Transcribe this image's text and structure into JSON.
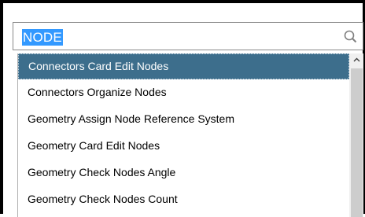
{
  "search": {
    "value": "NODE",
    "icon": "search-icon"
  },
  "results": [
    {
      "label": "Connectors Card Edit Nodes",
      "selected": true
    },
    {
      "label": "Connectors Organize Nodes",
      "selected": false
    },
    {
      "label": "Geometry Assign Node Reference System",
      "selected": false
    },
    {
      "label": "Geometry Card Edit Nodes",
      "selected": false
    },
    {
      "label": "Geometry Check Nodes Angle",
      "selected": false
    },
    {
      "label": "Geometry Check Nodes Count",
      "selected": false
    }
  ],
  "colors": {
    "selection_background": "#3d6e8c",
    "text_highlight": "#3399ff"
  }
}
